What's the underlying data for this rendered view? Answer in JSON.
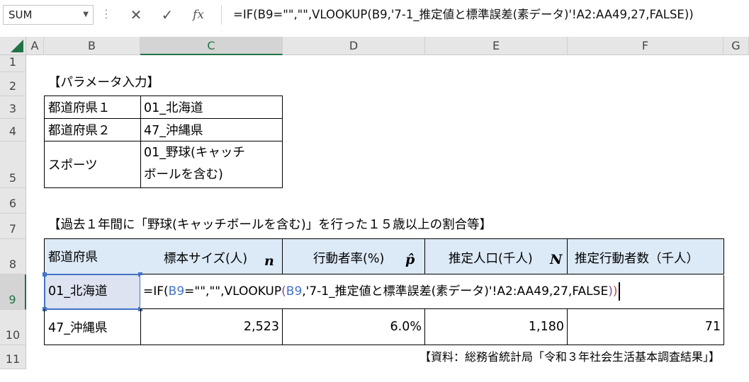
{
  "formula_bar": {
    "name_box": "SUM",
    "cancel_icon": "✕",
    "enter_icon": "✓",
    "fx_label": "fx",
    "formula": "=IF(B9=\"\",\"\",VLOOKUP(B9,'7-1_推定値と標準誤差(素データ)'!A2:AA49,27,FALSE))"
  },
  "columns": [
    "A",
    "B",
    "C",
    "D",
    "E",
    "F",
    "G"
  ],
  "rows": [
    "1",
    "2",
    "3",
    "4",
    "5",
    "6",
    "7",
    "8",
    "9",
    "10",
    "11"
  ],
  "param_section": {
    "title": "【パラメータ入力】",
    "rows": [
      {
        "label": "都道府県１",
        "value": "01_北海道"
      },
      {
        "label": "都道府県２",
        "value": "47_沖縄県"
      },
      {
        "label": "スポーツ",
        "value_line1": "01_野球(キャッチ",
        "value_line2": "ボールを含む)"
      }
    ]
  },
  "result_section": {
    "title": "【過去１年間に「野球(キャッチボールを含む)」を行った１５歳以上の割合等】",
    "headers": [
      {
        "label": "都道府県",
        "symbol": ""
      },
      {
        "label": "標本サイズ(人)",
        "symbol": "n"
      },
      {
        "label": "行動者率(%)",
        "symbol": "p̂"
      },
      {
        "label": "推定人口(千人)",
        "symbol": "N"
      },
      {
        "label": "推定行動者数（千人）",
        "symbol": ""
      }
    ],
    "row9": {
      "pref": "01_北海道",
      "edit_parts": [
        "=IF(",
        "B9",
        "=\"\",\"\",VLOOKUP",
        "(",
        "B9",
        ",'7-1_推定値と標準誤差(素データ)'!A2:AA49,27,FALSE",
        ")",
        ")"
      ]
    },
    "row10": {
      "pref": "47_沖縄県",
      "sample": "2,523",
      "rate": "6.0%",
      "pop": "1,180",
      "actors": "71"
    }
  },
  "source_note": "【資料：総務省統計局「令和３年社会生活基本調査結果」】"
}
